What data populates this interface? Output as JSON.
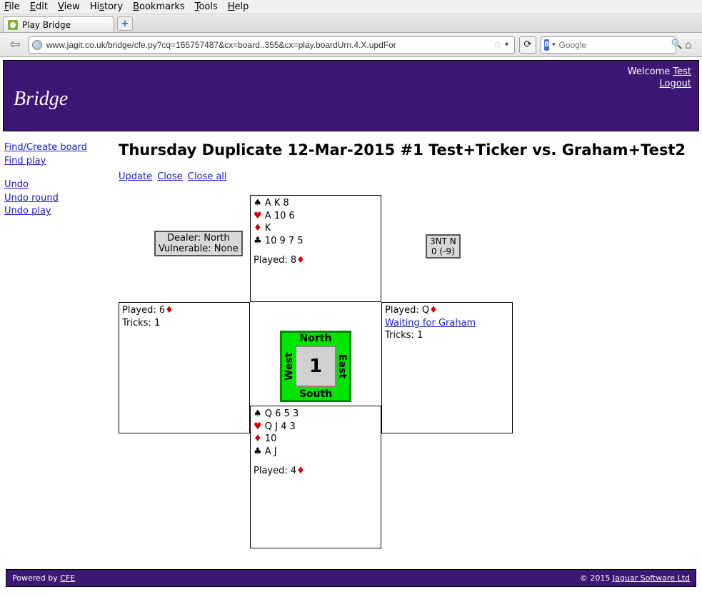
{
  "chrome": {
    "menus": [
      "File",
      "Edit",
      "View",
      "History",
      "Bookmarks",
      "Tools",
      "Help"
    ],
    "tab_title": "Play Bridge",
    "url": "www.jagit.co.uk/bridge/cfe.py?cq=165757487&cx=board..355&cx=play.boardUrn.4.X.updFor",
    "search_placeholder": "Google"
  },
  "banner": {
    "brand": "Bridge",
    "welcome": "Welcome ",
    "user": "Test",
    "logout": "Logout"
  },
  "side": {
    "find_board": "Find/Create board",
    "find_play": "Find play",
    "undo": "Undo",
    "undo_round": "Undo round",
    "undo_play": "Undo play"
  },
  "heading": "Thursday Duplicate 12-Mar-2015 #1 Test+Ticker vs. Graham+Test2",
  "actions": {
    "update": "Update",
    "close": "Close",
    "close_all": "Close all"
  },
  "info": {
    "dealer": "Dealer: North",
    "vul": "Vulnerable: None"
  },
  "contract": {
    "line1": "3NT N",
    "line2": "0 (-9)"
  },
  "compass": {
    "n": "North",
    "s": "South",
    "e": "East",
    "w": "West",
    "num": "1"
  },
  "hands": {
    "north": {
      "spades": "A K 8",
      "hearts": "A 10 6",
      "diamonds": "K",
      "clubs": "10 9 7 5",
      "played_prefix": "Played: ",
      "played_card": "8",
      "played_suit": "♦"
    },
    "south": {
      "spades": "Q 6 5 3",
      "hearts": "Q J 4 3",
      "diamonds": "10",
      "clubs": "A J",
      "played_prefix": "Played: ",
      "played_card": "4",
      "played_suit": "♦"
    },
    "west": {
      "played_prefix": "Played: ",
      "played_card": "6",
      "played_suit": "♦",
      "tricks": "Tricks: 1"
    },
    "east": {
      "played_prefix": "Played: ",
      "played_card": "Q",
      "played_suit": "♦",
      "waiting": "Waiting for Graham",
      "tricks": "Tricks: 1"
    }
  },
  "footer": {
    "powered": "Powered by ",
    "cfe": "CFE",
    "copy": "©  2015 ",
    "company": "Jaguar Software Ltd"
  }
}
